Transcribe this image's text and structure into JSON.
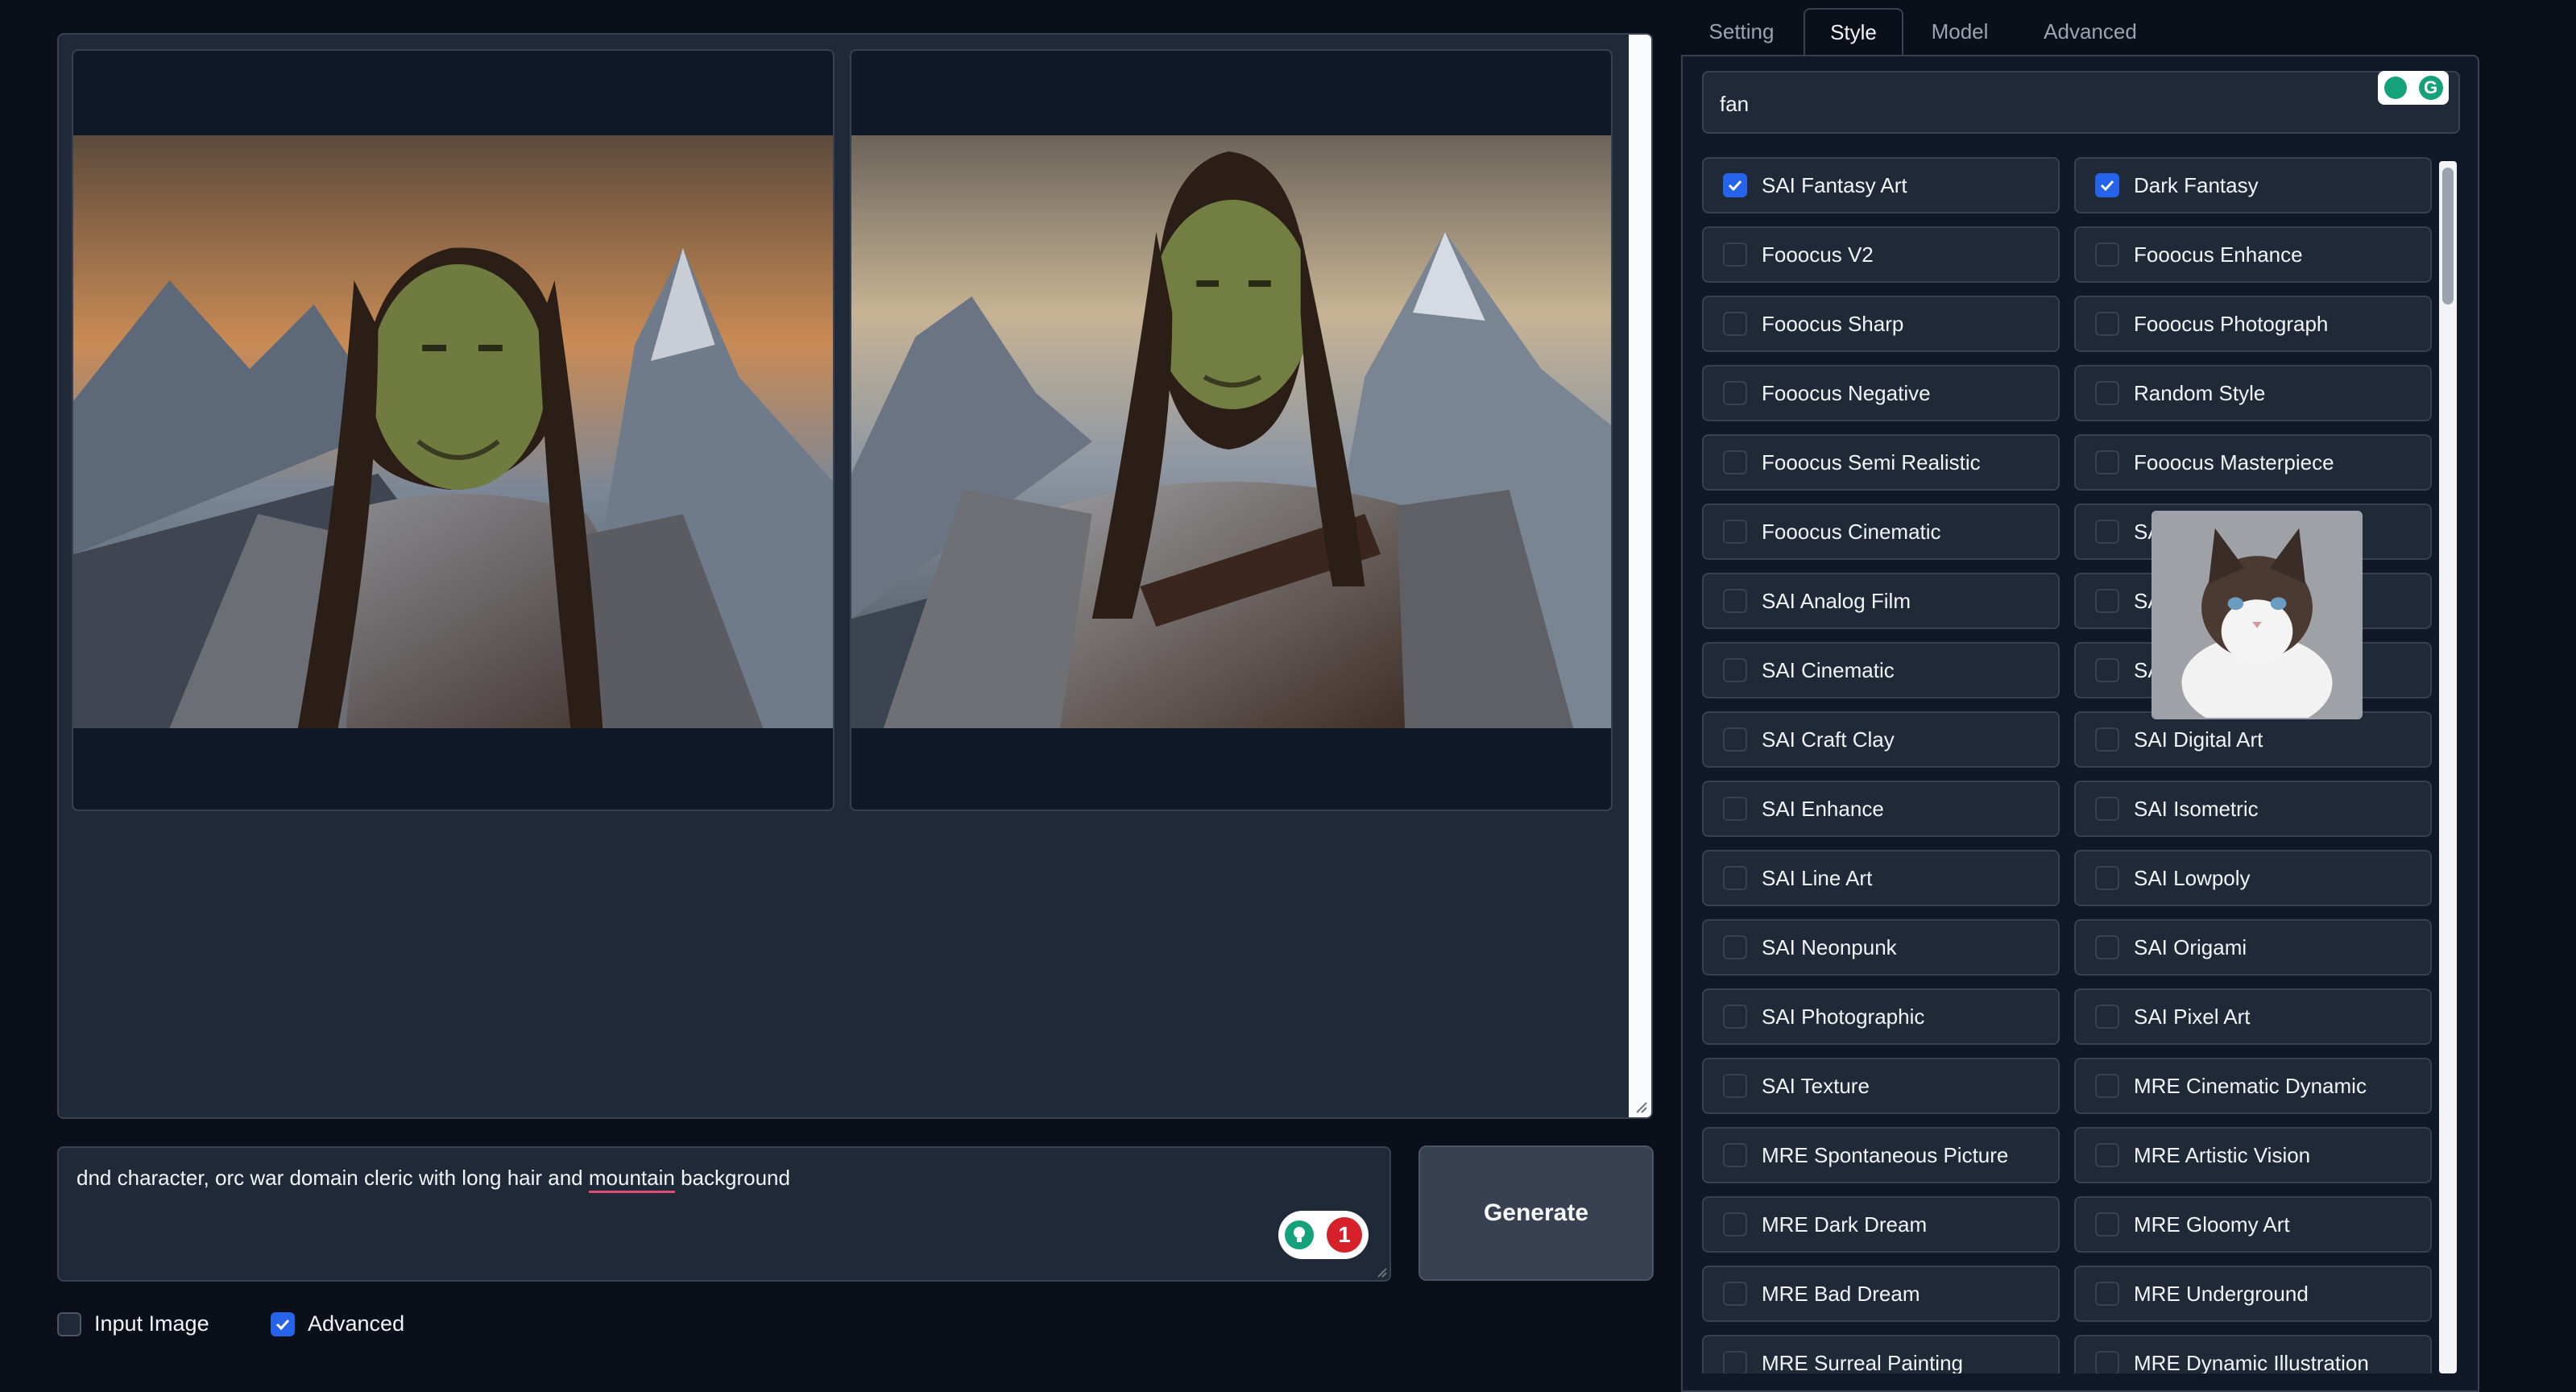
{
  "tabs": [
    "Setting",
    "Style",
    "Model",
    "Advanced"
  ],
  "active_tab": "Style",
  "search": {
    "value": "fan"
  },
  "prompt": {
    "before": "dnd character, orc war domain cleric with long hair and ",
    "flagged": "mountain",
    "after": " background",
    "issue_count": "1"
  },
  "generate_label": "Generate",
  "options": {
    "input_image": {
      "label": "Input Image",
      "checked": false
    },
    "advanced": {
      "label": "Advanced",
      "checked": true
    }
  },
  "styles": [
    {
      "label": "SAI Fantasy Art",
      "checked": true
    },
    {
      "label": "Dark Fantasy",
      "checked": true
    },
    {
      "label": "Fooocus V2",
      "checked": false
    },
    {
      "label": "Fooocus Enhance",
      "checked": false
    },
    {
      "label": "Fooocus Sharp",
      "checked": false
    },
    {
      "label": "Fooocus Photograph",
      "checked": false
    },
    {
      "label": "Fooocus Negative",
      "checked": false
    },
    {
      "label": "Random Style",
      "checked": false
    },
    {
      "label": "Fooocus Semi Realistic",
      "checked": false
    },
    {
      "label": "Fooocus Masterpiece",
      "checked": false
    },
    {
      "label": "Fooocus Cinematic",
      "checked": false
    },
    {
      "label": "SA",
      "checked": false
    },
    {
      "label": "SAI Analog Film",
      "checked": false
    },
    {
      "label": "SA",
      "checked": false
    },
    {
      "label": "SAI Cinematic",
      "checked": false
    },
    {
      "label": "SA",
      "checked": false
    },
    {
      "label": "SAI Craft Clay",
      "checked": false
    },
    {
      "label": "SAI Digital Art",
      "checked": false
    },
    {
      "label": "SAI Enhance",
      "checked": false
    },
    {
      "label": "SAI Isometric",
      "checked": false
    },
    {
      "label": "SAI Line Art",
      "checked": false
    },
    {
      "label": "SAI Lowpoly",
      "checked": false
    },
    {
      "label": "SAI Neonpunk",
      "checked": false
    },
    {
      "label": "SAI Origami",
      "checked": false
    },
    {
      "label": "SAI Photographic",
      "checked": false
    },
    {
      "label": "SAI Pixel Art",
      "checked": false
    },
    {
      "label": "SAI Texture",
      "checked": false
    },
    {
      "label": "MRE Cinematic Dynamic",
      "checked": false
    },
    {
      "label": "MRE Spontaneous Picture",
      "checked": false
    },
    {
      "label": "MRE Artistic Vision",
      "checked": false
    },
    {
      "label": "MRE Dark Dream",
      "checked": false
    },
    {
      "label": "MRE Gloomy Art",
      "checked": false
    },
    {
      "label": "MRE Bad Dream",
      "checked": false
    },
    {
      "label": "MRE Underground",
      "checked": false
    },
    {
      "label": "MRE Surreal Painting",
      "checked": false
    },
    {
      "label": "MRE Dynamic Illustration",
      "checked": false
    }
  ]
}
